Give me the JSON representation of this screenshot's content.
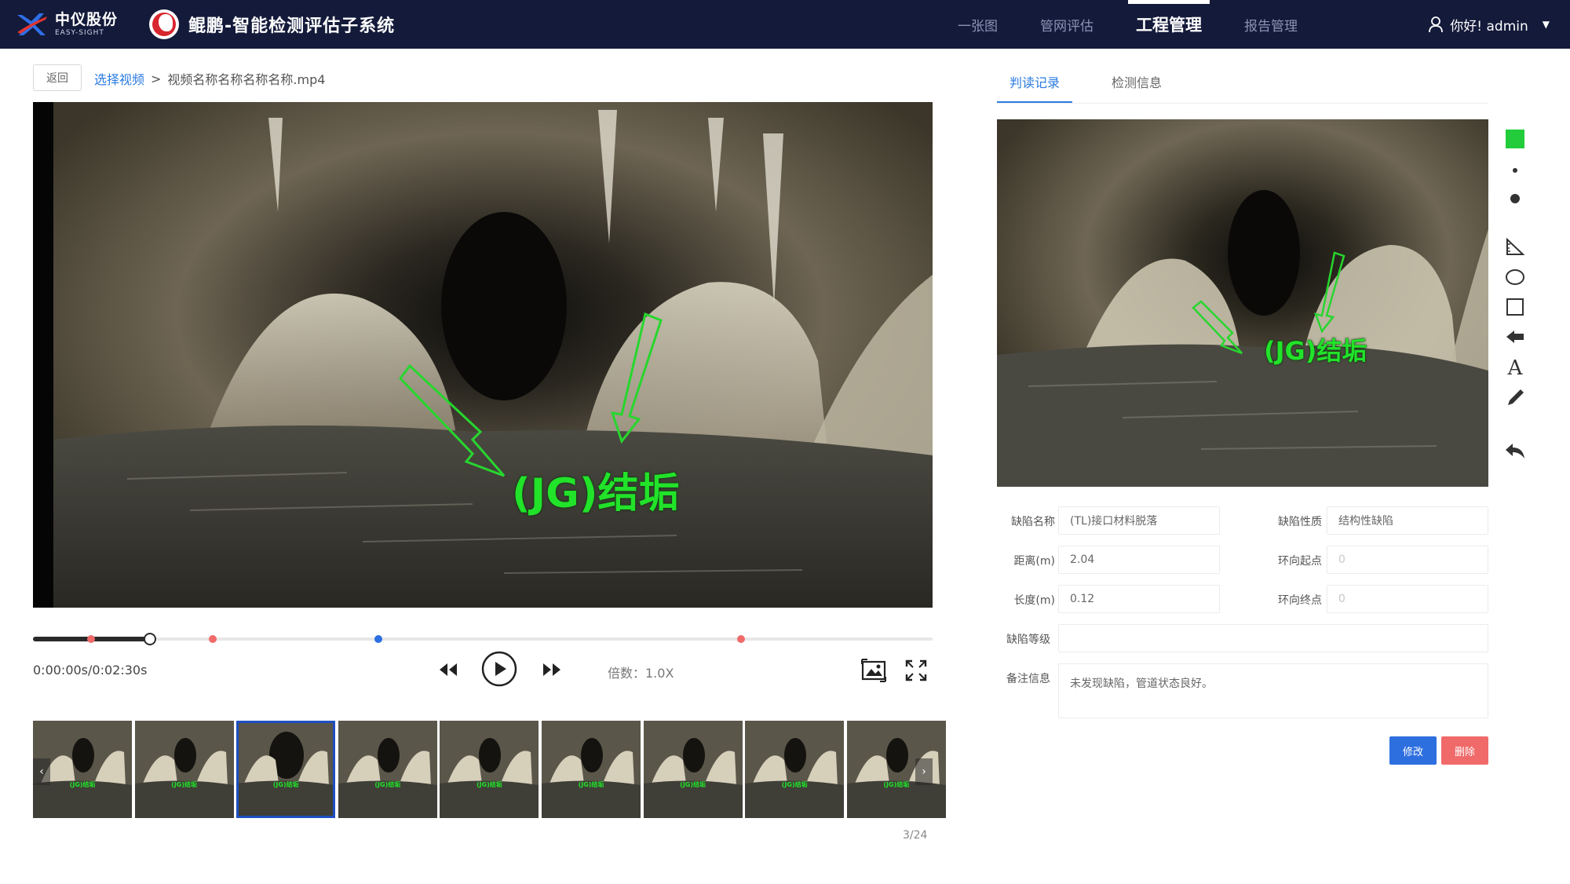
{
  "app": {
    "brand_cn": "中仪股份",
    "brand_en": "EASY-SIGHT",
    "system_title": "鲲鹏-智能检测评估子系统"
  },
  "nav": {
    "items": [
      {
        "label": "一张图",
        "active": false
      },
      {
        "label": "管网评估",
        "active": false
      },
      {
        "label": "工程管理",
        "active": true
      },
      {
        "label": "报告管理",
        "active": false
      }
    ]
  },
  "user": {
    "greeting": "你好! admin"
  },
  "breadcrumb": {
    "back_label": "返回",
    "link_label": "选择视频",
    "separator": ">",
    "current": "视频名称名称名称名称.mp4"
  },
  "player": {
    "annotation": "(JG)结垢",
    "progress": 0.13,
    "markers": [
      {
        "position": 0.065,
        "color": "#f06a6a"
      },
      {
        "position": 0.2,
        "color": "#f06a6a"
      },
      {
        "position": 0.384,
        "color": "#2b6fe0"
      },
      {
        "position": 0.787,
        "color": "#f06a6a"
      }
    ],
    "time": "0:00:00s/0:02:30s",
    "speed": "倍数：1.0X"
  },
  "thumbnails": {
    "count": 9,
    "active_index": 2,
    "label": "(JG)结垢",
    "page": "3/24"
  },
  "panel": {
    "tabs": [
      {
        "label": "判读记录",
        "active": true
      },
      {
        "label": "检测信息",
        "active": false
      }
    ],
    "annotation": "(JG)结垢",
    "tool_color": "#22cc3a",
    "fields": {
      "defect_name_label": "缺陷名称",
      "defect_name_value": "(TL)接口材料脱落",
      "defect_nature_label": "缺陷性质",
      "defect_nature_value": "结构性缺陷",
      "distance_label": "距离(m)",
      "distance_value": "2.04",
      "ring_start_label": "环向起点",
      "ring_start_value": "0",
      "length_label": "长度(m)",
      "length_value": "0.12",
      "ring_end_label": "环向终点",
      "ring_end_value": "0",
      "grade_label": "缺陷等级",
      "grade_value": "",
      "remark_label": "备注信息",
      "remark_value": "未发现缺陷，管道状态良好。"
    },
    "buttons": {
      "edit": "修改",
      "delete": "删除"
    }
  }
}
